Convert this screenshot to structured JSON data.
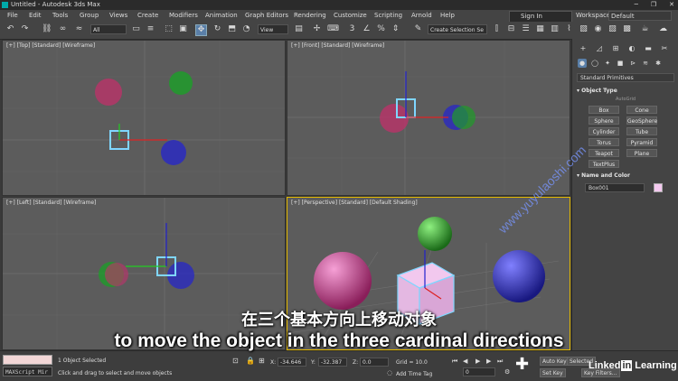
{
  "window": {
    "title": "Untitled - Autodesk 3ds Max"
  },
  "menu": [
    "File",
    "Edit",
    "Tools",
    "Group",
    "Views",
    "Create",
    "Modifiers",
    "Animation",
    "Graph Editors",
    "Rendering",
    "Customize",
    "Scripting",
    "Arnold",
    "Help"
  ],
  "account": {
    "sign_in": "Sign In",
    "workspaces_label": "Workspaces:",
    "workspace": "Default"
  },
  "toolbar": {
    "filter": "All",
    "ref_coord": "View",
    "selection_set": "Create Selection Se"
  },
  "viewports": {
    "top": "[+] [Top] [Standard] [Wireframe]",
    "front": "[+] [Front] [Standard] [Wireframe]",
    "left": "[+] [Left] [Standard] [Wireframe]",
    "perspective": "[+] [Perspective] [Standard] [Default Shading]"
  },
  "command_panel": {
    "category": "Standard Primitives",
    "object_type_title": "Object Type",
    "autogrid": "AutoGrid",
    "primitives": [
      "Box",
      "Cone",
      "Sphere",
      "GeoSphere",
      "Cylinder",
      "Tube",
      "Torus",
      "Pyramid",
      "Teapot",
      "Plane",
      "TextPlus"
    ],
    "name_color_title": "Name and Color",
    "object_name": "Box001"
  },
  "status": {
    "maxscript": "MAXScript Mir",
    "selected": "1 Object Selected",
    "prompt": "Click and drag to select and move objects",
    "x_label": "X:",
    "x": "-34.646",
    "y_label": "Y:",
    "y": "-32.387",
    "z_label": "Z:",
    "z": "0.0",
    "grid": "Grid = 10.0",
    "add_time_tag": "Add Time Tag",
    "frame": "0",
    "auto_key": "Auto Key",
    "set_key": "Set Key",
    "key_mode": "Selected",
    "key_filters": "Key Filters..."
  },
  "subtitles": {
    "zh": "在三个基本方向上移动对象",
    "en": "to move the object in the three cardinal directions"
  },
  "watermark": "www.yuyulaoshi.com",
  "branding": {
    "linked": "Linked",
    "in": "in",
    "learning": "Learning"
  },
  "colors": {
    "pink": "#c0306a",
    "green": "#1f9b2a",
    "blue": "#2a2ac0",
    "selection": "#7fd6ff",
    "active_border": "#e2b800"
  }
}
